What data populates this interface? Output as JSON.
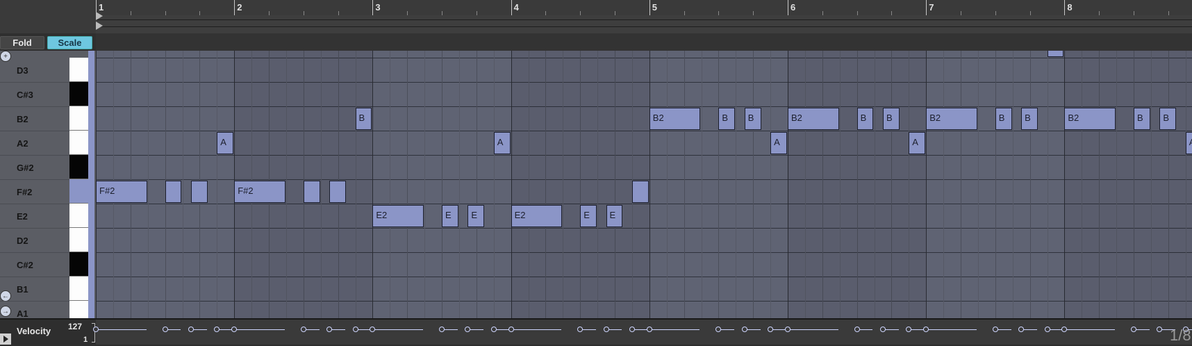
{
  "ruler": {
    "bars": [
      "1",
      "2",
      "3",
      "4",
      "5",
      "6",
      "7",
      "8"
    ]
  },
  "header": {
    "fold_label": "Fold",
    "scale_label": "Scale"
  },
  "keys": [
    {
      "label": "D3",
      "color": "white"
    },
    {
      "label": "C#3",
      "color": "black"
    },
    {
      "label": "B2",
      "color": "white"
    },
    {
      "label": "A2",
      "color": "white"
    },
    {
      "label": "G#2",
      "color": "black"
    },
    {
      "label": "F#2",
      "color": "active"
    },
    {
      "label": "E2",
      "color": "white"
    },
    {
      "label": "D2",
      "color": "white"
    },
    {
      "label": "C#2",
      "color": "black"
    },
    {
      "label": "B1",
      "color": "white"
    },
    {
      "label": "A1",
      "color": "white"
    }
  ],
  "notes": [
    {
      "pitch": "F#2",
      "start": 0,
      "len": 0.375,
      "label": "F#2"
    },
    {
      "pitch": "F#2",
      "start": 0.5,
      "len": 0.125,
      "label": ""
    },
    {
      "pitch": "F#2",
      "start": 0.6875,
      "len": 0.125,
      "label": ""
    },
    {
      "pitch": "A2",
      "start": 0.875,
      "len": 0.125,
      "label": "A"
    },
    {
      "pitch": "F#2",
      "start": 1.0,
      "len": 0.375,
      "label": "F#2"
    },
    {
      "pitch": "F#2",
      "start": 1.5,
      "len": 0.125,
      "label": ""
    },
    {
      "pitch": "F#2",
      "start": 1.6875,
      "len": 0.125,
      "label": ""
    },
    {
      "pitch": "B2",
      "start": 1.875,
      "len": 0.125,
      "label": "B"
    },
    {
      "pitch": "E2",
      "start": 2.0,
      "len": 0.375,
      "label": "E2"
    },
    {
      "pitch": "E2",
      "start": 2.5,
      "len": 0.125,
      "label": "E"
    },
    {
      "pitch": "E2",
      "start": 2.6875,
      "len": 0.125,
      "label": "E"
    },
    {
      "pitch": "A2",
      "start": 2.875,
      "len": 0.125,
      "label": "A"
    },
    {
      "pitch": "E2",
      "start": 3.0,
      "len": 0.375,
      "label": "E2"
    },
    {
      "pitch": "E2",
      "start": 3.5,
      "len": 0.125,
      "label": "E"
    },
    {
      "pitch": "E2",
      "start": 3.6875,
      "len": 0.125,
      "label": "E"
    },
    {
      "pitch": "F#2",
      "start": 3.875,
      "len": 0.125,
      "label": ""
    },
    {
      "pitch": "B2",
      "start": 4.0,
      "len": 0.375,
      "label": "B2"
    },
    {
      "pitch": "B2",
      "start": 4.5,
      "len": 0.125,
      "label": "B"
    },
    {
      "pitch": "B2",
      "start": 4.6875,
      "len": 0.125,
      "label": "B"
    },
    {
      "pitch": "A2",
      "start": 4.875,
      "len": 0.125,
      "label": "A"
    },
    {
      "pitch": "B2",
      "start": 5.0,
      "len": 0.375,
      "label": "B2"
    },
    {
      "pitch": "B2",
      "start": 5.5,
      "len": 0.125,
      "label": "B"
    },
    {
      "pitch": "B2",
      "start": 5.6875,
      "len": 0.125,
      "label": "B"
    },
    {
      "pitch": "A2",
      "start": 5.875,
      "len": 0.125,
      "label": "A"
    },
    {
      "pitch": "B2",
      "start": 6.0,
      "len": 0.375,
      "label": "B2"
    },
    {
      "pitch": "B2",
      "start": 6.5,
      "len": 0.125,
      "label": "B"
    },
    {
      "pitch": "B2",
      "start": 6.6875,
      "len": 0.125,
      "label": "B"
    },
    {
      "pitch": "D3+",
      "start": 6.875,
      "len": 0.125,
      "label": ""
    },
    {
      "pitch": "B2",
      "start": 7.0,
      "len": 0.375,
      "label": "B2"
    },
    {
      "pitch": "B2",
      "start": 7.5,
      "len": 0.125,
      "label": "B"
    },
    {
      "pitch": "B2",
      "start": 7.6875,
      "len": 0.125,
      "label": "B"
    },
    {
      "pitch": "A2",
      "start": 7.875,
      "len": 0.125,
      "label": "A"
    }
  ],
  "velocity": {
    "label": "Velocity",
    "max": "127",
    "min": "1",
    "grid_readout": "1/8"
  },
  "colors": {
    "note": "#8b95c7",
    "grid": "#5f6373",
    "scale_button": "#6ec7e0"
  }
}
